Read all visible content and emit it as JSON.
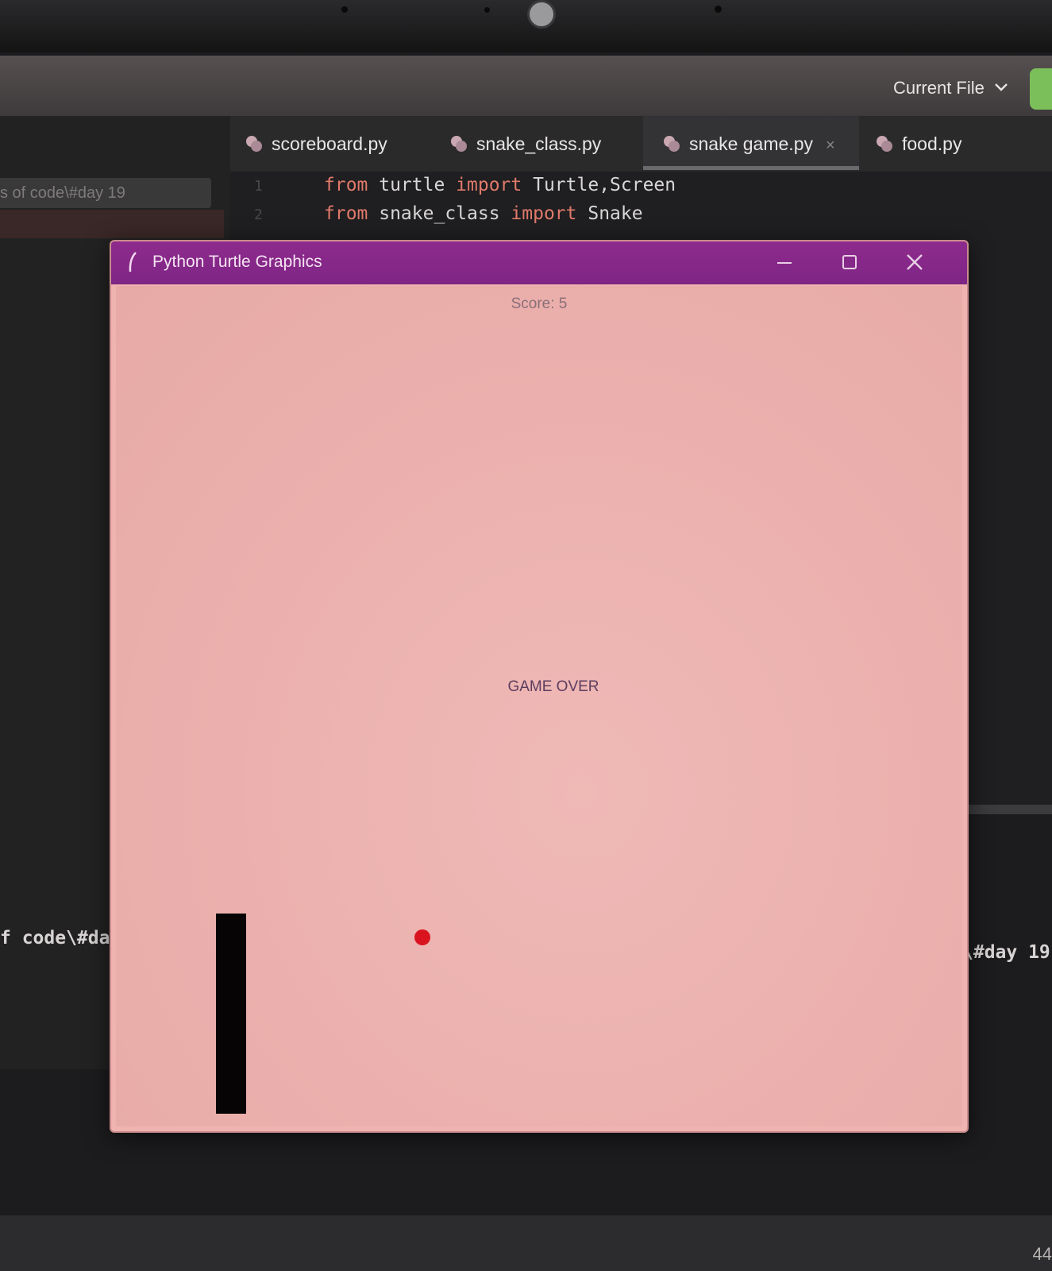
{
  "toolbar": {
    "run_config_label": "Current File"
  },
  "project_panel": {
    "path_fragment": "s of code\\#day 19"
  },
  "tabs": [
    {
      "label": "scoreboard.py",
      "icon": "python-file-icon",
      "active": false
    },
    {
      "label": "snake_class.py",
      "icon": "python-file-icon",
      "active": false
    },
    {
      "label": "snake game.py",
      "icon": "python-file-icon",
      "active": true,
      "close": "×"
    },
    {
      "label": "food.py",
      "icon": "python-file-icon",
      "active": false
    }
  ],
  "editor": {
    "line_numbers": [
      "1",
      "2"
    ],
    "line1": {
      "kw1": "from",
      "mod": " turtle ",
      "kw2": "import",
      "rest": " Turtle,Screen"
    },
    "line2": {
      "kw1": "from",
      "mod": " snake_class ",
      "kw2": "import",
      "rest": " Snake"
    }
  },
  "terminal": {
    "left_fragment": "f code\\#da",
    "right_fragment": "\\#day 19"
  },
  "statusbar": {
    "number": "44"
  },
  "turtle_window": {
    "title": "Python Turtle Graphics",
    "score_text": "Score: 5",
    "game_over_text": "GAME OVER"
  },
  "colors": {
    "titlebar": "#8e2b8c",
    "canvas": "#efb3b0",
    "snake": "#060405",
    "food": "#d9141f",
    "keyword": "#e07a6b"
  }
}
